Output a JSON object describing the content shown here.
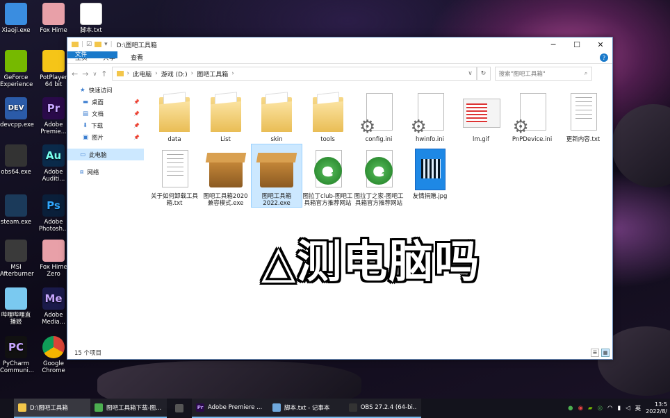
{
  "desktop": {
    "icons": [
      {
        "label": "Xiaoji.exe",
        "icon": "xiaoji-icon",
        "color": "#3a8de0"
      },
      {
        "label": "Fox Hime",
        "icon": "anime-icon",
        "color": "#e8a0a8"
      },
      {
        "label": "脚本.txt",
        "icon": "text-file-icon",
        "color": "#ffffff"
      },
      {
        "label": "GeForce Experience",
        "icon": "nvidia-icon",
        "color": "#76b900"
      },
      {
        "label": "PotPlayer 64 bit",
        "icon": "potplayer-icon",
        "color": "#f5c518"
      },
      {
        "label": "devcpp.exe",
        "icon": "devcpp-icon",
        "color": "#2b5ba8"
      },
      {
        "label": "Adobe Premie...",
        "icon": "premiere-icon",
        "color": "#2a0a4a"
      },
      {
        "label": "obs64.exe",
        "icon": "obs-icon",
        "color": "#333333"
      },
      {
        "label": "Adobe Auditi...",
        "icon": "audition-icon",
        "color": "#0a2a4a"
      },
      {
        "label": "steam.exe",
        "icon": "steam-icon",
        "color": "#1b3a5a"
      },
      {
        "label": "Adobe Photosh...",
        "icon": "photoshop-icon",
        "color": "#0a1f3a"
      },
      {
        "label": "MSI Afterburner",
        "icon": "msi-icon",
        "color": "#3a3a3a"
      },
      {
        "label": "Fox Hime Zero",
        "icon": "anime-icon",
        "color": "#e8a0a8"
      },
      {
        "label": "哔哩哔哩直播姬",
        "icon": "bilibili-icon",
        "color": "#7ac9f0"
      },
      {
        "label": "Adobe Media...",
        "icon": "media-encoder-icon",
        "color": "#1a1a4a"
      },
      {
        "label": "PyCharm Communi...",
        "icon": "pycharm-icon",
        "color": "#111111"
      },
      {
        "label": "Google Chrome",
        "icon": "chrome-icon",
        "color": "#e8e8e8"
      }
    ],
    "overlay_text": "△测电脑吗"
  },
  "window": {
    "title": "D:\\图吧工具箱",
    "controls": {
      "minimize": "─",
      "maximize": "☐",
      "close": "✕"
    },
    "ribbon_tabs": [
      "文件",
      "主页",
      "共享",
      "查看"
    ],
    "help": "?",
    "address": {
      "parts": [
        "此电脑",
        "游戏 (D:)",
        "图吧工具箱"
      ]
    },
    "search_placeholder": "搜索\"图吧工具箱\"",
    "sidebar": [
      {
        "label": "快速访问",
        "icon": "star-icon",
        "pinned": false
      },
      {
        "label": "桌面",
        "icon": "desktop-icon",
        "pinned": true
      },
      {
        "label": "文档",
        "icon": "documents-icon",
        "pinned": true
      },
      {
        "label": "下载",
        "icon": "download-icon",
        "pinned": true
      },
      {
        "label": "图片",
        "icon": "pictures-icon",
        "pinned": true
      },
      {
        "label": "此电脑",
        "icon": "pc-icon",
        "pinned": false
      },
      {
        "label": "网络",
        "icon": "network-icon",
        "pinned": false
      }
    ],
    "files": [
      {
        "name": "data",
        "type": "folder"
      },
      {
        "name": "List",
        "type": "folder"
      },
      {
        "name": "skin",
        "type": "folder"
      },
      {
        "name": "tools",
        "type": "folder"
      },
      {
        "name": "config.ini",
        "type": "ini"
      },
      {
        "name": "hwinfo.ini",
        "type": "ini"
      },
      {
        "name": "lm.gif",
        "type": "gif"
      },
      {
        "name": "PnPDevice.ini",
        "type": "ini"
      },
      {
        "name": "更新内容.txt",
        "type": "txt"
      },
      {
        "name": "关于如何卸载工具箱.txt",
        "type": "txt"
      },
      {
        "name": "图吧工具箱2020兼容模式.exe",
        "type": "exe"
      },
      {
        "name": "图吧工具箱2022.exe",
        "type": "exe"
      },
      {
        "name": "图拉丁club-图吧工具箱官方推荐网站",
        "type": "url"
      },
      {
        "name": "图拉丁之家-图吧工具箱官方推荐网站",
        "type": "url"
      },
      {
        "name": "友情捐赠.jpg",
        "type": "jpg"
      }
    ],
    "status": "15 个项目"
  },
  "taskbar": {
    "apps": [
      {
        "label": "D:\\图吧工具箱",
        "icon": "folder-icon",
        "color": "#f3c64a"
      },
      {
        "label": "图吧工具箱下载-图...",
        "icon": "browser-icon",
        "color": "#4caf50"
      },
      {
        "label": "",
        "icon": "window-icon",
        "color": "#555555"
      },
      {
        "label": "Adobe Premiere ...",
        "icon": "premiere-icon",
        "color": "#2a0a4a"
      },
      {
        "label": "脚本.txt - 记事本",
        "icon": "notepad-icon",
        "color": "#6fa8dc"
      },
      {
        "label": "OBS 27.2.4 (64-bi...",
        "icon": "obs-icon",
        "color": "#333333"
      }
    ],
    "ime": "英",
    "time": "13:5",
    "date": "2022/8/"
  }
}
